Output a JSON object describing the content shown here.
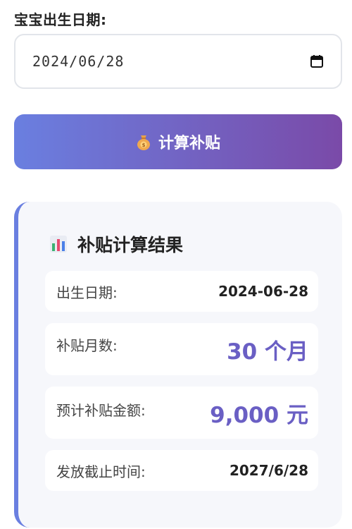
{
  "form": {
    "birth_date_label": "宝宝出生日期:",
    "birth_date_value": "2024/06/28",
    "calendar_icon": "calendar-icon"
  },
  "action": {
    "calculate_label": "计算补贴",
    "icon": "money-bag-icon"
  },
  "result": {
    "title": "补贴计算结果",
    "title_icon": "bar-chart-icon",
    "rows": [
      {
        "label": "出生日期:",
        "value": "2024-06-28"
      },
      {
        "label": "补贴月数:",
        "value": "30 个月"
      },
      {
        "label": "预计补贴金额:",
        "value": "9,000 元"
      },
      {
        "label": "发放截止时间:",
        "value": "2027/6/28"
      }
    ]
  },
  "colors": {
    "accent": "#6a5fc4",
    "gradient_start": "#6a7fe0",
    "gradient_end": "#7a4aa8",
    "card_background": "#f6f7fb"
  }
}
